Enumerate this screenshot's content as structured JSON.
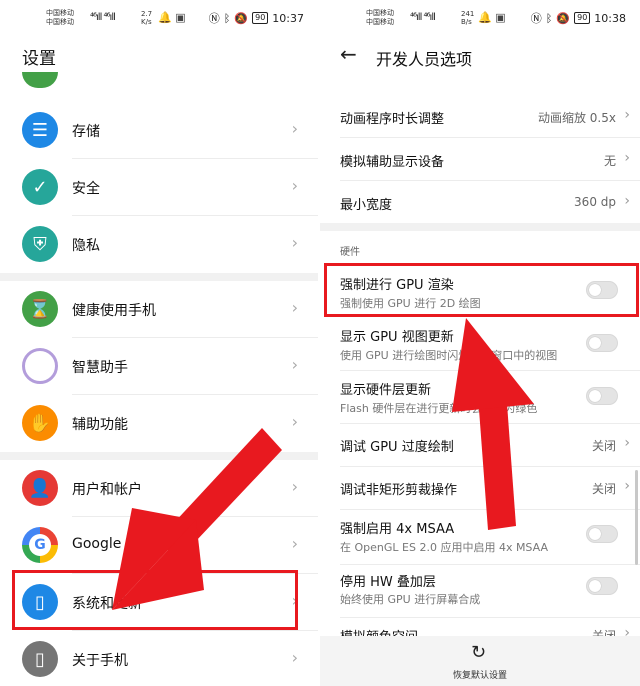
{
  "left": {
    "status": {
      "carrier1": "中国移动",
      "carrier2": "中国移动",
      "signal": "⁴⁶ıll ⁴⁶ıll",
      "speed_value": "2.7",
      "speed_unit": "K/s",
      "battery": "90",
      "time": "10:37"
    },
    "title": "设置",
    "items": [
      {
        "label": "存储",
        "color": "#1e88e5",
        "icon": "storage-icon"
      },
      {
        "label": "安全",
        "color": "#26a69a",
        "icon": "shield-icon"
      },
      {
        "label": "隐私",
        "color": "#26a69a",
        "icon": "privacy-icon"
      },
      {
        "label": "健康使用手机",
        "color": "#43a047",
        "icon": "hourglass-icon"
      },
      {
        "label": "智慧助手",
        "color": "#b39ddb",
        "icon": "assistant-icon"
      },
      {
        "label": "辅助功能",
        "color": "#fb8c00",
        "icon": "hand-icon"
      },
      {
        "label": "用户和帐户",
        "color": "#e53935",
        "icon": "user-icon"
      },
      {
        "label": "Google",
        "color": "#ffffff",
        "icon": "google-icon"
      },
      {
        "label": "系统和更新",
        "color": "#1e88e5",
        "icon": "phone-settings-icon"
      },
      {
        "label": "关于手机",
        "color": "#757575",
        "icon": "phone-info-icon"
      }
    ]
  },
  "right": {
    "status": {
      "carrier1": "中国移动",
      "carrier2": "中国移动",
      "signal": "⁴⁶ıll ⁴⁶ıll",
      "speed_value": "241",
      "speed_unit": "B/s",
      "battery": "90",
      "time": "10:38"
    },
    "title": "开发人员选项",
    "rows": [
      {
        "title": "动画程序时长调整",
        "value": "动画缩放 0.5x"
      },
      {
        "title": "模拟辅助显示设备",
        "value": "无"
      },
      {
        "title": "最小宽度",
        "value": "360 dp"
      }
    ],
    "section": "硬件",
    "hw_rows": [
      {
        "title": "强制进行 GPU 渲染",
        "sub": "强制使用 GPU 进行 2D 绘图"
      },
      {
        "title": "显示 GPU 视图更新",
        "sub": "使用 GPU 进行绘图时闪烁显示窗口中的视图"
      },
      {
        "title": "显示硬件层更新",
        "sub": "Flash 硬件层在进行更新时会显示为绿色"
      },
      {
        "title": "调试 GPU 过度绘制",
        "value": "关闭"
      },
      {
        "title": "调试非矩形剪裁操作",
        "value": "关闭"
      },
      {
        "title": "强制启用 4x MSAA",
        "sub": "在 OpenGL ES 2.0 应用中启用 4x MSAA"
      },
      {
        "title": "停用 HW 叠加层",
        "sub": "始终使用 GPU 进行屏幕合成"
      },
      {
        "title": "模拟颜色空间",
        "value": "关闭"
      }
    ],
    "reset_label": "恢复默认设置"
  },
  "colors": {
    "highlight": "#e8191f",
    "arrow": "#e8191f"
  }
}
